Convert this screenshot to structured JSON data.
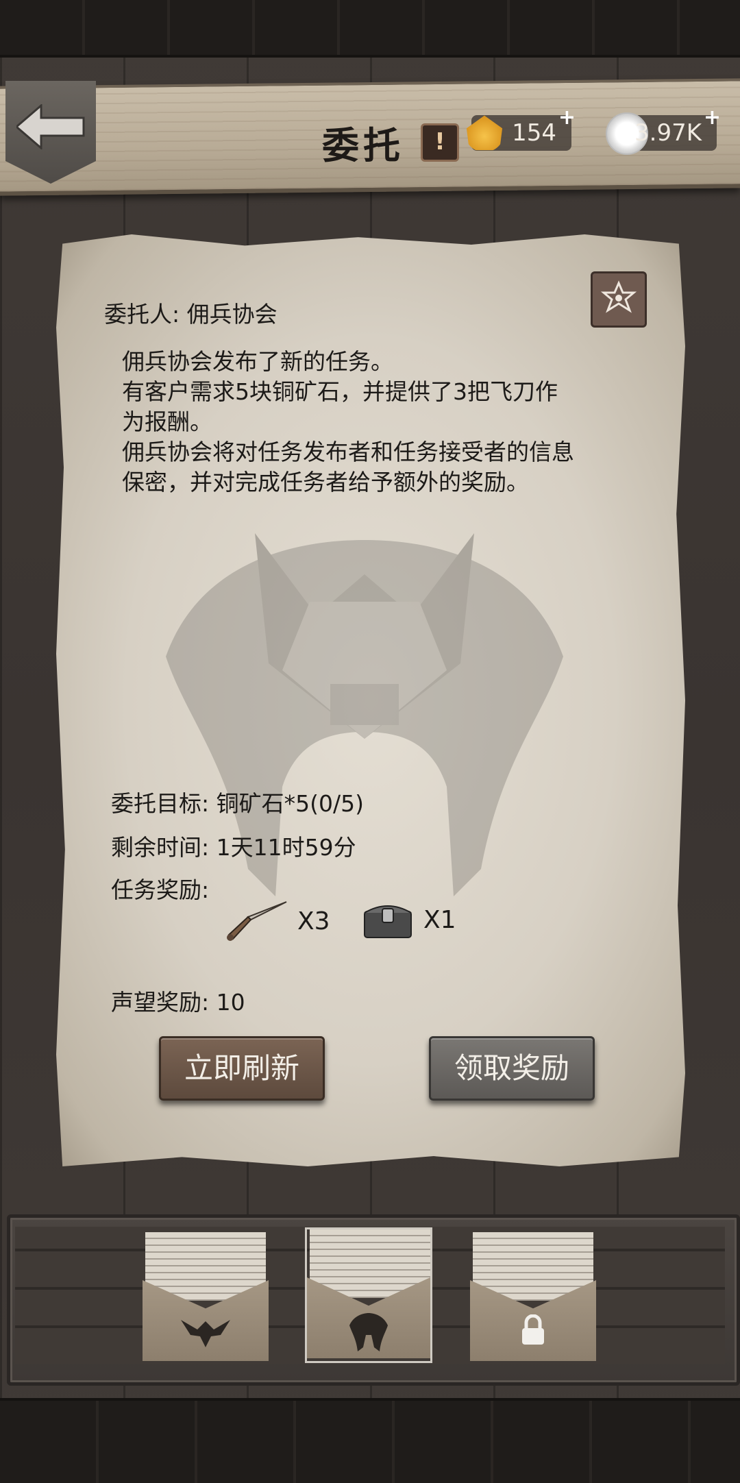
{
  "header": {
    "title": "委托",
    "alert_glyph": "!",
    "currencies": [
      {
        "icon": "shell-icon",
        "value": "154",
        "plus": "+"
      },
      {
        "icon": "coin-icon",
        "value": "3.97K",
        "plus": "+"
      }
    ]
  },
  "quest": {
    "client_label": "委托人: 佣兵协会",
    "description": [
      "佣兵协会发布了新的任务。",
      "有客户需求5块铜矿石，并提供了3把飞刀作",
      "为报酬。",
      "佣兵协会将对任务发布者和任务接受者的信息",
      "保密，并对完成任务者给予额外的奖励。"
    ],
    "target": "委托目标: 铜矿石*5(0/5)",
    "time_left": "剩余时间: 1天11时59分",
    "rewards_label": "任务奖励:",
    "rewards": [
      {
        "icon": "throwing-knife-icon",
        "quantity": "X3"
      },
      {
        "icon": "chest-icon",
        "quantity": "X1"
      }
    ],
    "reputation": "声望奖励: 10"
  },
  "buttons": {
    "refresh": "立即刷新",
    "claim": "领取奖励"
  },
  "tray": {
    "envelopes": [
      {
        "icon": "eagle-emblem-icon",
        "selected": false
      },
      {
        "icon": "wolf-emblem-icon",
        "selected": true
      },
      {
        "icon": "lock-icon",
        "selected": false
      }
    ]
  },
  "colors": {
    "parchment": "#d7d0c4",
    "refresh_button": "#6b5647",
    "claim_button": "#6b6866",
    "background": "#3b3632"
  }
}
